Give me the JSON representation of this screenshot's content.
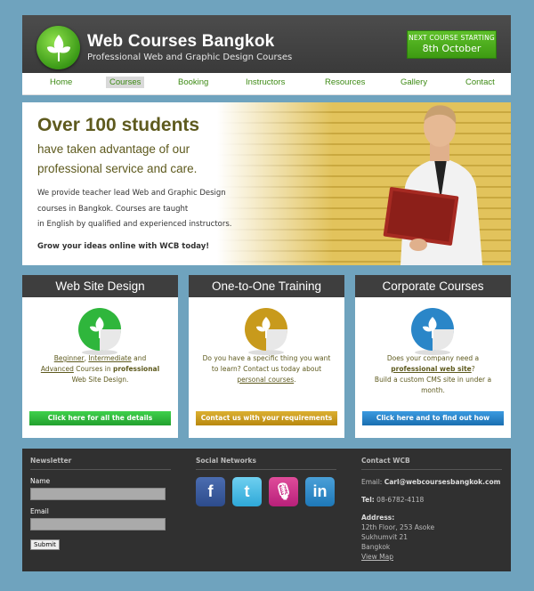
{
  "header": {
    "title": "Web Courses Bangkok",
    "subtitle": "Professional Web and Graphic Design Courses",
    "next_course_label": "NEXT COURSE STARTING",
    "next_course_date": "8th October"
  },
  "nav": {
    "items": [
      {
        "label": "Home"
      },
      {
        "label": "Courses",
        "active": true
      },
      {
        "label": "Booking"
      },
      {
        "label": "Instructors"
      },
      {
        "label": "Resources"
      },
      {
        "label": "Gallery"
      },
      {
        "label": "Contact"
      }
    ]
  },
  "hero": {
    "heading": "Over 100 students",
    "subheading": "have taken advantage of our professional service and care.",
    "body_line1": "We provide teacher lead Web and Graphic Design",
    "body_line2": "courses in Bangkok. Courses are taught",
    "body_line3": "in English by qualified and experienced instructors.",
    "cta": "Grow your ideas online with WCB today!"
  },
  "boxes": [
    {
      "title": "Web Site Design",
      "link1": "Beginner",
      "sep1": ", ",
      "link2": "Intermediate",
      "text1": " and",
      "link3": "Advanced",
      "text2": " Courses in ",
      "bold": "professional",
      "text3": "Web Site Design.",
      "button": "Click here for all the details",
      "color": "#2fb63c"
    },
    {
      "title": "One-to-One Training",
      "text1": "Do you have a specific thing you want",
      "text2": "to learn? Contact us today about",
      "link1": "personal courses",
      "text3": ".",
      "button": "Contact us with your requirements",
      "color": "#c89a1c"
    },
    {
      "title": "Corporate Courses",
      "text1": "Does your company need a",
      "link1": "professional web site",
      "text2": "?",
      "text3": "Build a custom CMS site in under a month.",
      "button": "Click here and to find out how",
      "color": "#2a86c8"
    }
  ],
  "footer": {
    "newsletter": {
      "heading": "Newsletter",
      "name_label": "Name",
      "email_label": "Email",
      "submit": "Submit"
    },
    "social": {
      "heading": "Social Networks",
      "icons": [
        "facebook-icon",
        "twitter-icon",
        "podcast-icon",
        "linkedin-icon"
      ]
    },
    "contact": {
      "heading": "Contact WCB",
      "email_label": "Email:",
      "email": "Carl@webcoursesbangkok.com",
      "tel_label": "Tel:",
      "tel": "08-6782-4118",
      "address_label": "Address:",
      "address1": "12th Floor, 253 Asoke",
      "address2": "Sukhumvit 21",
      "address3": "Bangkok",
      "map": "View Map"
    }
  },
  "colors": {
    "page_bg": "#6fa3be",
    "accent_green": "#3d8a14",
    "header_bg": "#3e3e3e"
  }
}
